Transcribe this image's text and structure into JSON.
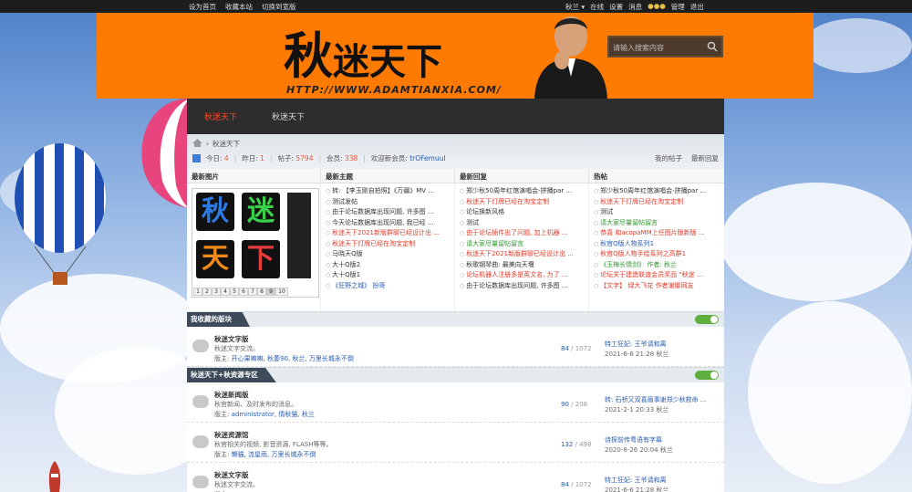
{
  "topbar": {
    "left_links": [
      "设为首页",
      "收藏本站",
      "切换到宽版"
    ],
    "right_links": [
      "秋兰 ▾",
      "在线",
      "设置",
      "消息",
      "管理",
      "退出"
    ]
  },
  "banner": {
    "logo_big": "秋",
    "logo_rest": "迷天下",
    "logo_url": "HTTP://WWW.ADAMTIANXIA.COM/",
    "search_placeholder": "请输入搜索内容"
  },
  "nav": {
    "items": [
      "秋迷天下",
      "秋迷天下"
    ]
  },
  "breadcrumb": {
    "current": "秋迷天下",
    "stats": {
      "today_label": "今日:",
      "today": "4",
      "yesterday_label": "昨日:",
      "yesterday": "1",
      "posts_label": "帖子:",
      "posts": "5794",
      "members_label": "会员:",
      "members": "338",
      "welcome_label": "欢迎新会员:",
      "new_member": "trOFemuul"
    },
    "right_links": [
      "我的帖子",
      "最新回复"
    ]
  },
  "columns": {
    "headers": [
      "最新图片",
      "最新主题",
      "最新回复",
      "热帖"
    ],
    "image_pager": [
      "1",
      "2",
      "3",
      "4",
      "5",
      "6",
      "7",
      "8",
      "9",
      "10"
    ],
    "image_tiles": [
      "秋",
      "迷",
      "天",
      "下"
    ],
    "latest_topics": [
      {
        "t": "转: 【李玉刚自拍照】《万疆》MV ...",
        "c": "dk"
      },
      {
        "t": "测试发帖",
        "c": "dk"
      },
      {
        "t": "由于论坛数据库出现问题, 许多图 ...",
        "c": "dk"
      },
      {
        "t": "今天论坛数据库出现问题, 我已经 ...",
        "c": "dk"
      },
      {
        "t": "秋迷天下2021新版群聊已经设计出 ...",
        "c": "red"
      },
      {
        "t": "秋迷天下灯牌已经在淘宝定制",
        "c": "red"
      },
      {
        "t": "马晓天Q版",
        "c": "dk"
      },
      {
        "t": "大十Q版2",
        "c": "dk"
      },
      {
        "t": "大十Q版1",
        "c": "dk"
      },
      {
        "t": "《狂野之城》 扮哥",
        "c": "blue"
      }
    ],
    "latest_replies": [
      {
        "t": "郑少秋50周年红馆演唱会-拼播par ...",
        "c": "dk"
      },
      {
        "t": "秋迷天下灯牌已经在淘宝定制",
        "c": "red"
      },
      {
        "t": "论坛换新风格",
        "c": "dk"
      },
      {
        "t": "测试",
        "c": "dk"
      },
      {
        "t": "由于论坛插件出了问题, 加上机器 ...",
        "c": "red"
      },
      {
        "t": "请大家尽量留帖留言",
        "c": "green"
      },
      {
        "t": "秋迷天下2021新版群聊已经设计出 ...",
        "c": "red"
      },
      {
        "t": "秋歌钢琴曲: 最美向天堰",
        "c": "dk"
      },
      {
        "t": "论坛机器人注册多是英文名, 为了 ...",
        "c": "red"
      },
      {
        "t": "由于论坛数据库出现问题, 许多图 ...",
        "c": "dk"
      }
    ],
    "hot_posts": [
      {
        "t": "郑少秋50周年红馆演唱会-拼播par ...",
        "c": "dk"
      },
      {
        "t": "秋迷天下灯牌已经在淘宝定制",
        "c": "red"
      },
      {
        "t": "测试",
        "c": "dk"
      },
      {
        "t": "请大家尽量留帖留言",
        "c": "green"
      },
      {
        "t": "恭喜 和acopaMM上任图片版新版 ...",
        "c": "red"
      },
      {
        "t": "秋官Q版人物系列1",
        "c": "blue"
      },
      {
        "t": "秋官Q版人物手绘系列之高群1",
        "c": "red"
      },
      {
        "t": "《玉梅长情剑》 作者: 秋兰",
        "c": "green"
      },
      {
        "t": "论坛关于建造联谊会员奖品 \"秋迷 ...",
        "c": "red"
      },
      {
        "t": "【文字】 绿大飞花 作者谢娜网友",
        "c": "red"
      }
    ]
  },
  "sections": [
    {
      "title": "我收藏的版块",
      "forums": [
        {
          "name": "秋迷文字版",
          "desc": "秋迷文字交流。",
          "mod_label": "版主:",
          "mods": "开心果嘛嘛, 秋萎90, 秋兰, 万里长城永不倒",
          "topics": "84",
          "posts": "1072",
          "last_title": "特工狂妃: 王爷请和离",
          "last_time": "2021-6-6 21:28",
          "last_user": "秋兰"
        }
      ]
    },
    {
      "title": "秋迷天下+秋资源专区",
      "forums": [
        {
          "name": "秋迷新闻版",
          "desc": "秋官新闻、及时发布的消息。",
          "mod_label": "版主:",
          "mods": "administrator, 情秋猫, 秋兰",
          "topics": "90",
          "posts": "208",
          "last_title": "转: 石桥又双喜眉事谢郑少秋救命 ...",
          "last_time": "2021-2-1 20:33",
          "last_user": "秋兰"
        },
        {
          "name": "秋迷资源馆",
          "desc": "秋官相关的视频, 影音资源, FLASH等等。",
          "mod_label": "版主:",
          "mods": "懒猫, 流星雨, 万里长城永不倒",
          "topics": "132",
          "posts": "498",
          "last_title": "诗探前传粤语有字幕",
          "last_time": "2020-8-26 20:04",
          "last_user": "秋兰"
        },
        {
          "name": "秋迷文字版",
          "desc": "秋迷文字交流。",
          "mod_label": "版主:",
          "mods": "",
          "topics": "84",
          "posts": "1072",
          "last_title": "特工狂妃: 王爷请和离",
          "last_time": "2021-6-6 21:28",
          "last_user": "秋兰"
        }
      ]
    }
  ]
}
